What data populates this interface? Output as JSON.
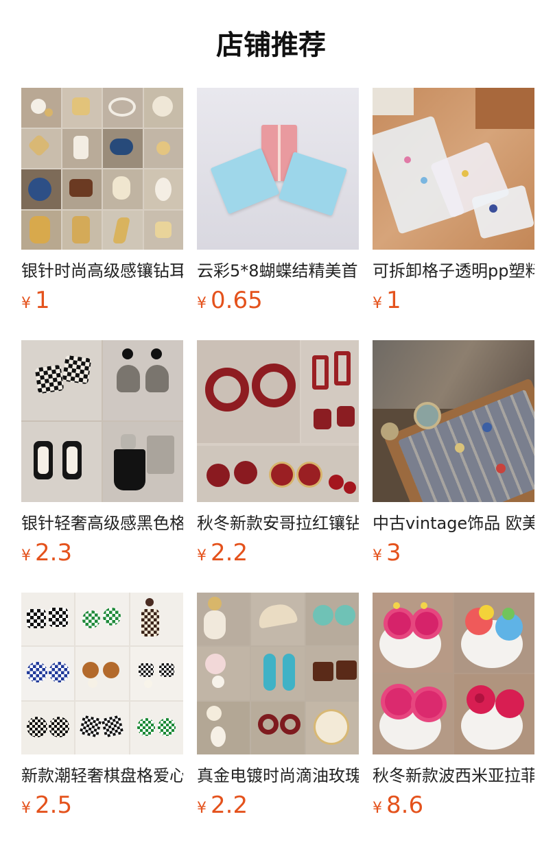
{
  "header": {
    "title": "店铺推荐"
  },
  "currency_symbol": "¥",
  "products": [
    {
      "name": "银针时尚高级感镶钻耳",
      "price": "1",
      "image": "earrings-collage-pearl-gold"
    },
    {
      "name": "云彩5*8蝴蝶结精美首",
      "price": "0.65",
      "image": "gift-boxes-pink-blue"
    },
    {
      "name": "可拆卸格子透明pp塑料",
      "price": "1",
      "image": "clear-storage-boxes"
    },
    {
      "name": "银针轻奢高级感黑色格",
      "price": "2.3",
      "image": "black-checker-earrings"
    },
    {
      "name": "秋冬新款安哥拉红镶钻",
      "price": "2.2",
      "image": "red-enamel-earrings"
    },
    {
      "name": "中古vintage饰品 欧美",
      "price": "3",
      "image": "vintage-jewelry-trays"
    },
    {
      "name": "新款潮轻奢棋盘格爱心",
      "price": "2.5",
      "image": "checkerboard-earrings-grid"
    },
    {
      "name": "真金电镀时尚滴油玫瑰",
      "price": "2.2",
      "image": "gold-enamel-earrings-collage"
    },
    {
      "name": "秋冬新款波西米亚拉菲",
      "price": "8.6",
      "image": "bohemian-flower-earrings"
    }
  ],
  "colors": {
    "price": "#e4521c",
    "title": "#111111"
  }
}
